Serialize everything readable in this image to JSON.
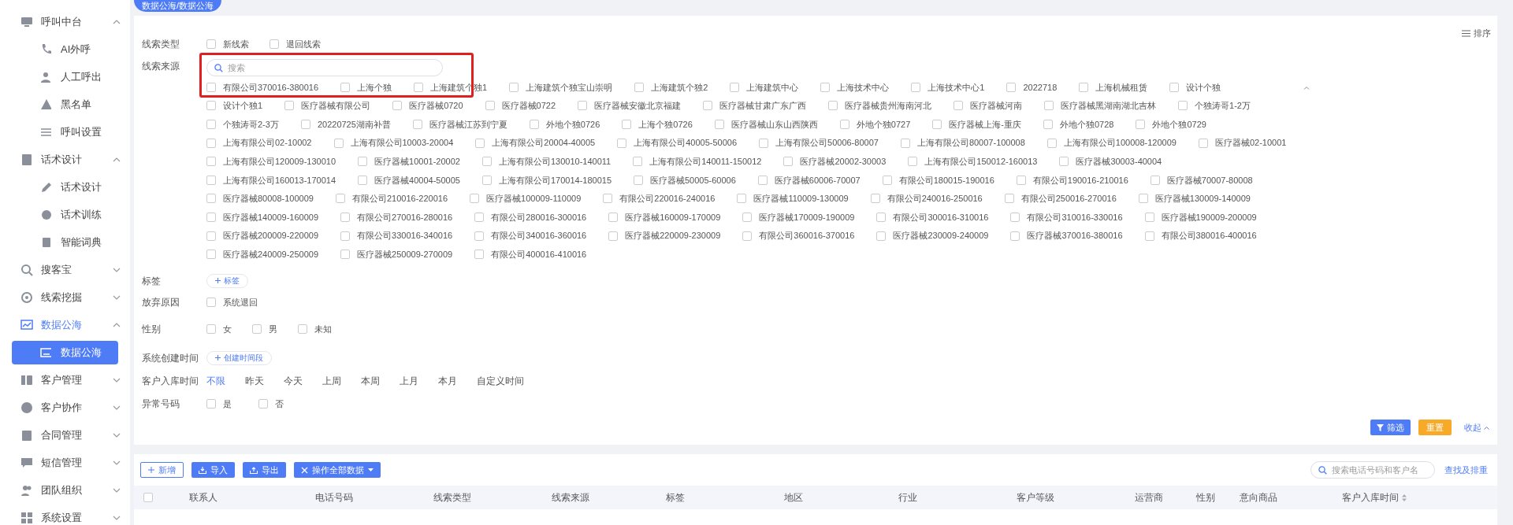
{
  "sidebar": {
    "items": [
      {
        "label": "呼叫中台",
        "expanded": true,
        "children": [
          {
            "label": "AI外呼",
            "selected": false
          },
          {
            "label": "人工呼出",
            "selected": false
          },
          {
            "label": "黑名单",
            "selected": false
          },
          {
            "label": "呼叫设置",
            "selected": false
          }
        ]
      },
      {
        "label": "话术设计",
        "expanded": true,
        "children": [
          {
            "label": "话术设计",
            "selected": false
          },
          {
            "label": "话术训练",
            "selected": false
          },
          {
            "label": "智能词典",
            "selected": false
          }
        ]
      },
      {
        "label": "搜客宝",
        "expanded": false
      },
      {
        "label": "线索挖掘",
        "expanded": false
      },
      {
        "label": "数据公海",
        "expanded": true,
        "children": [
          {
            "label": "数据公海",
            "selected": true
          }
        ]
      },
      {
        "label": "客户管理",
        "expanded": false
      },
      {
        "label": "客户协作",
        "expanded": false
      },
      {
        "label": "合同管理",
        "expanded": false
      },
      {
        "label": "短信管理",
        "expanded": false
      },
      {
        "label": "团队组织",
        "expanded": false
      },
      {
        "label": "系统设置",
        "expanded": false
      }
    ]
  },
  "page_tabs": [
    {
      "label": "数据公海/数据公海",
      "selected": true
    }
  ],
  "filters": {
    "sort_button": "排序",
    "lead_type": {
      "label": "线索类型",
      "options": [
        {
          "label": "新线索",
          "checked": false
        },
        {
          "label": "退回线索",
          "checked": false
        }
      ]
    },
    "lead_source": {
      "label": "线索来源",
      "search_placeholder": "搜索",
      "options": [
        {
          "label": "有限公司370016-380016",
          "checked": false
        },
        {
          "label": "上海个独",
          "checked": false
        },
        {
          "label": "上海建筑个独1",
          "checked": false
        },
        {
          "label": "上海建筑个独宝山崇明",
          "checked": false
        },
        {
          "label": "上海建筑个独2",
          "checked": false
        },
        {
          "label": "上海建筑中心",
          "checked": false
        },
        {
          "label": "上海技术中心",
          "checked": false
        },
        {
          "label": "上海技术中心1",
          "checked": false
        },
        {
          "label": "2022718",
          "checked": false
        },
        {
          "label": "上海机械租赁",
          "checked": false
        },
        {
          "label": "设计个独",
          "checked": false
        },
        {
          "label": "设计个独1",
          "checked": false
        },
        {
          "label": "医疗器械有限公司",
          "checked": false
        },
        {
          "label": "医疗器械0720",
          "checked": false
        },
        {
          "label": "医疗器械0722",
          "checked": false
        },
        {
          "label": "医疗器械安徽北京福建",
          "checked": false
        },
        {
          "label": "医疗器械甘肃广东广西",
          "checked": false
        },
        {
          "label": "医疗器械贵州海南河北",
          "checked": false
        },
        {
          "label": "医疗器械河南",
          "checked": false
        },
        {
          "label": "医疗器械黑湖南湖北吉林",
          "checked": false
        },
        {
          "label": "个独涛哥1-2万",
          "checked": false
        },
        {
          "label": "个独涛哥2-3万",
          "checked": false
        },
        {
          "label": "20220725湖南补普",
          "checked": false
        },
        {
          "label": "医疗器械江苏到宁夏",
          "checked": false
        },
        {
          "label": "外地个独0726",
          "checked": false
        },
        {
          "label": "上海个独0726",
          "checked": false
        },
        {
          "label": "医疗器械山东山西陕西",
          "checked": false
        },
        {
          "label": "外地个独0727",
          "checked": false
        },
        {
          "label": "医疗器械上海-重庆",
          "checked": false
        },
        {
          "label": "外地个独0728",
          "checked": false
        },
        {
          "label": "外地个独0729",
          "checked": false
        },
        {
          "label": "上海有限公司02-10002",
          "checked": false
        },
        {
          "label": "上海有限公司10003-20004",
          "checked": false
        },
        {
          "label": "上海有限公司20004-40005",
          "checked": false
        },
        {
          "label": "上海有限公司40005-50006",
          "checked": false
        },
        {
          "label": "上海有限公司50006-80007",
          "checked": false
        },
        {
          "label": "上海有限公司80007-100008",
          "checked": false
        },
        {
          "label": "上海有限公司100008-120009",
          "checked": false
        },
        {
          "label": "医疗器械02-10001",
          "checked": false
        },
        {
          "label": "上海有限公司120009-130010",
          "checked": false
        },
        {
          "label": "医疗器械10001-20002",
          "checked": false
        },
        {
          "label": "上海有限公司130010-140011",
          "checked": false
        },
        {
          "label": "上海有限公司140011-150012",
          "checked": false
        },
        {
          "label": "医疗器械20002-30003",
          "checked": false
        },
        {
          "label": "上海有限公司150012-160013",
          "checked": false
        },
        {
          "label": "医疗器械30003-40004",
          "checked": false
        },
        {
          "label": "上海有限公司160013-170014",
          "checked": false
        },
        {
          "label": "医疗器械40004-50005",
          "checked": false
        },
        {
          "label": "上海有限公司170014-180015",
          "checked": false
        },
        {
          "label": "医疗器械50005-60006",
          "checked": false
        },
        {
          "label": "医疗器械60006-70007",
          "checked": false
        },
        {
          "label": "有限公司180015-190016",
          "checked": false
        },
        {
          "label": "有限公司190016-210016",
          "checked": false
        },
        {
          "label": "医疗器械70007-80008",
          "checked": false
        },
        {
          "label": "医疗器械80008-100009",
          "checked": false
        },
        {
          "label": "有限公司210016-220016",
          "checked": false
        },
        {
          "label": "医疗器械100009-110009",
          "checked": false
        },
        {
          "label": "有限公司220016-240016",
          "checked": false
        },
        {
          "label": "医疗器械110009-130009",
          "checked": false
        },
        {
          "label": "有限公司240016-250016",
          "checked": false
        },
        {
          "label": "有限公司250016-270016",
          "checked": false
        },
        {
          "label": "医疗器械130009-140009",
          "checked": false
        },
        {
          "label": "医疗器械140009-160009",
          "checked": false
        },
        {
          "label": "有限公司270016-280016",
          "checked": false
        },
        {
          "label": "有限公司280016-300016",
          "checked": false
        },
        {
          "label": "医疗器械160009-170009",
          "checked": false
        },
        {
          "label": "医疗器械170009-190009",
          "checked": false
        },
        {
          "label": "有限公司300016-310016",
          "checked": false
        },
        {
          "label": "有限公司310016-330016",
          "checked": false
        },
        {
          "label": "医疗器械190009-200009",
          "checked": false
        },
        {
          "label": "医疗器械200009-220009",
          "checked": false
        },
        {
          "label": "有限公司330016-340016",
          "checked": false
        },
        {
          "label": "有限公司340016-360016",
          "checked": false
        },
        {
          "label": "医疗器械220009-230009",
          "checked": false
        },
        {
          "label": "有限公司360016-370016",
          "checked": false
        },
        {
          "label": "医疗器械230009-240009",
          "checked": false
        },
        {
          "label": "医疗器械370016-380016",
          "checked": false
        },
        {
          "label": "有限公司380016-400016",
          "checked": false
        },
        {
          "label": "医疗器械240009-250009",
          "checked": false
        },
        {
          "label": "医疗器械250009-270009",
          "checked": false
        },
        {
          "label": "有限公司400016-410016",
          "checked": false
        }
      ]
    },
    "tag": {
      "label": "标签",
      "button": "标签"
    },
    "abandon_reason": {
      "label": "放弃原因",
      "options": [
        {
          "label": "系统退回",
          "checked": false
        }
      ]
    },
    "gender": {
      "label": "性别",
      "options": [
        {
          "label": "女",
          "checked": false
        },
        {
          "label": "男",
          "checked": false
        },
        {
          "label": "未知",
          "checked": false
        }
      ]
    },
    "created_time": {
      "label": "系统创建时间",
      "button": "创建时间段"
    },
    "entry_time": {
      "label": "客户入库时间",
      "options": [
        {
          "label": "不限",
          "selected": true
        },
        {
          "label": "昨天",
          "selected": false
        },
        {
          "label": "今天",
          "selected": false
        },
        {
          "label": "上周",
          "selected": false
        },
        {
          "label": "本周",
          "selected": false
        },
        {
          "label": "上月",
          "selected": false
        },
        {
          "label": "本月",
          "selected": false
        },
        {
          "label": "自定义时间",
          "selected": false
        }
      ]
    },
    "abnormal_number": {
      "label": "异常号码",
      "options": [
        {
          "label": "是",
          "checked": false
        },
        {
          "label": "否",
          "checked": false
        }
      ]
    },
    "filter_button": "筛选",
    "reset_button": "重置",
    "collapse_link": "收起"
  },
  "toolbar": {
    "add_button": "新增",
    "import_button": "导入",
    "export_button": "导出",
    "bulk_button": "操作全部数据",
    "search_placeholder": "搜索电话号码和客户名",
    "dedupe_link": "查找及排重"
  },
  "table": {
    "select_all_checked": false,
    "columns": [
      "联系人",
      "电话号码",
      "线索类型",
      "线索来源",
      "标签",
      "地区",
      "行业",
      "客户等级",
      "运营商",
      "性别",
      "意向商品",
      "客户入库时间"
    ]
  }
}
